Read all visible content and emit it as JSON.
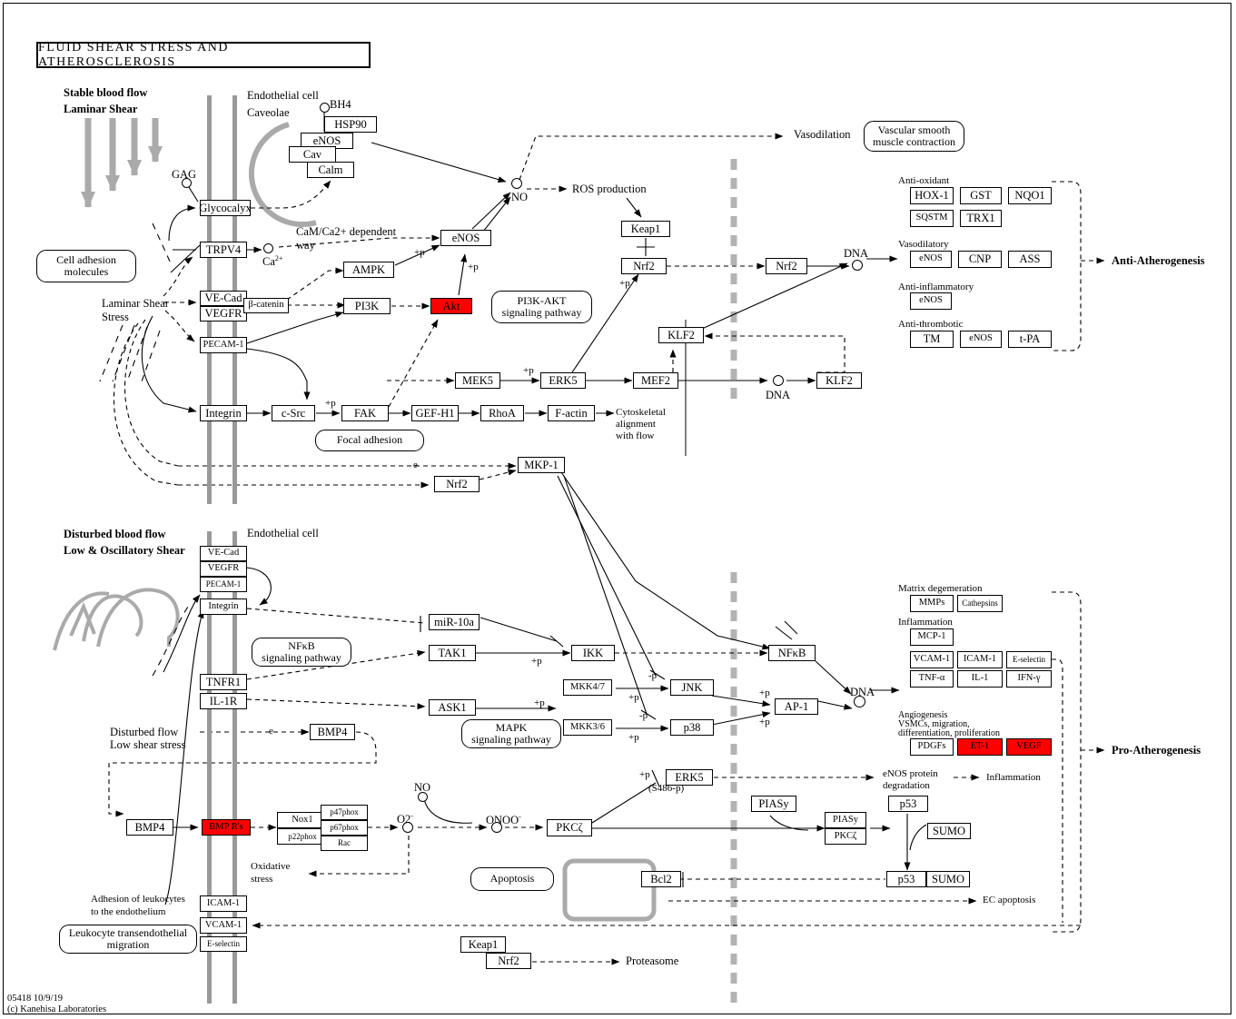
{
  "title": "FLUID  SHEAR  STRESS  AND  ATHEROSCLEROSIS",
  "footer": {
    "line1": "05418 10/9/19",
    "line2": "(c) Kanehisa Laboratories"
  },
  "colors": {
    "highlight": "#FF0000",
    "membrane": "#999999",
    "nucleus_divider": "#B3B3B3",
    "flow_arrow": "#AAAAAA"
  },
  "labels": {
    "stable_flow_1": "Stable blood flow",
    "stable_flow_2": "Laminar Shear",
    "endothelial_cell_top": "Endothelial cell",
    "caveolae": "Caveolae",
    "gag": "GAG",
    "bh4": "BH4",
    "cam_way_1": "CaM/Ca2+ dependent",
    "cam_way_2": "way",
    "calcium": "Ca",
    "calcium_sup": "2+",
    "no": "NO",
    "ros_production": "ROS production",
    "vasodilation": "Vasodilation",
    "dna_1": "DNA",
    "dna_2": "DNA",
    "dna_3": "DNA",
    "laminar_shear_stress_1": "Laminar Shear",
    "laminar_shear_stress_2": "Stress",
    "cytoskeletal_1": "Cytoskeletal",
    "cytoskeletal_2": "alignment",
    "cytoskeletal_3": "with flow",
    "disturbed_flow_1": "Disturbed blood flow",
    "disturbed_flow_2": "Low & Oscillatory Shear",
    "endothelial_cell_bottom": "Endothelial cell",
    "disturbed_flow_low_1": "Disturbed flow",
    "disturbed_flow_low_2": "Low shear stress",
    "no_bottom": "NO",
    "o2_minus": "O2",
    "o2_sup": "-",
    "onoo": "ONOO",
    "onoo_sup": "-",
    "oxidative_1": "Oxidative",
    "oxidative_2": "stress",
    "s486p": "(S486-p)",
    "enos_degradation_1": "eNOS protein",
    "enos_degradation_2": "degradation",
    "inflammation_out": "Inflammation",
    "ec_apoptosis": "EC apoptosis",
    "proteasome": "Proteasome",
    "adhesion_1": "Adhesion of leukocytes",
    "adhesion_2": "to the endothelium",
    "anti_atherogenesis": "Anti-Atherogenesis",
    "pro_atherogenesis": "Pro-Atherogenesis",
    "plus_p": "+p",
    "minus_p": "-p",
    "e_label": "e"
  },
  "rounded_nodes": [
    {
      "id": "cell-adhesion-molecules",
      "text": "Cell adhesion\nmolecules"
    },
    {
      "id": "pi3k-akt-pathway",
      "text": "PI3K-AKT\nsignaling pathway"
    },
    {
      "id": "vascular-smooth-muscle",
      "text": "Vascular smooth\nmuscle contraction"
    },
    {
      "id": "focal-adhesion",
      "text": "Focal adhesion"
    },
    {
      "id": "nfkb-pathway",
      "text": "NFκB\nsignaling pathway"
    },
    {
      "id": "mapk-pathway",
      "text": "MAPK\nsignaling pathway"
    },
    {
      "id": "apoptosis",
      "text": "Apoptosis"
    },
    {
      "id": "leukocyte-migration",
      "text": "Leukocyte transendothelial\nmigration"
    }
  ],
  "genes": {
    "hsp90": "HSP90",
    "enos_cav": "eNOS",
    "cav": "Cav",
    "calm": "Calm",
    "glycocalyx": "Glycocalyx",
    "trpv4": "TRPV4",
    "ve_cad": "VE-Cad",
    "vegfr": "VEGFR",
    "beta_catenin": "β-catenin",
    "pecam1": "PECAM-1",
    "integrin": "Integrin",
    "ampk": "AMPK",
    "pi3k": "PI3K",
    "akt": "Akt",
    "enos2": "eNOS",
    "keap1": "Keap1",
    "nrf2_a": "Nrf2",
    "nrf2_b": "Nrf2",
    "klf2_a": "KLF2",
    "klf2_b": "KLF2",
    "mek5": "MEK5",
    "erk5": "ERK5",
    "mef2": "MEF2",
    "c_src": "c-Src",
    "fak": "FAK",
    "gef_h1": "GEF-H1",
    "rhoa": "RhoA",
    "f_actin": "F-actin",
    "mkp1": "MKP-1",
    "nrf2_c": "Nrf2",
    "ve_cad_2": "VE-Cad",
    "vegfr_2": "VEGFR",
    "pecam1_2": "PECAM-1",
    "integrin_2": "Integrin",
    "mir10a": "miR-10a",
    "tak1": "TAK1",
    "ikk": "IKK",
    "nfkb": "NFκB",
    "tnfr1": "TNFR1",
    "il1r": "IL-1R",
    "ask1": "ASK1",
    "mkk47": "MKK4/7",
    "jnk": "JNK",
    "ap1": "AP-1",
    "mkk346": "MKK3/6",
    "p38": "p38",
    "bmp4_a": "BMP4",
    "bmp4_b": "BMP4",
    "bmprs": "BMP R's",
    "nox1": "Nox1",
    "p22phox": "p22phox",
    "p47phox": "p47phox",
    "p67phox": "p67phox",
    "rac": "Rac",
    "pkcz": "PKCζ",
    "erk5_b": "ERK5",
    "piasy": "PIASy",
    "piasy_c": "PIASy",
    "pkcz_c": "PKCζ",
    "p53": "p53",
    "sumo": "SUMO",
    "p53_b": "p53",
    "sumo_b": "SUMO",
    "bcl2": "Bcl2",
    "icam1": "ICAM-1",
    "vcam1": "VCAM-1",
    "e_selectin": "E-selectin",
    "keap1_b": "Keap1",
    "nrf2_d": "Nrf2"
  },
  "anti_atherogenesis_groups": [
    {
      "group": "Anti-oxidant",
      "rows": [
        [
          "HOX-1",
          "GST",
          "NQO1"
        ],
        [
          "SQSTM",
          "TRX1"
        ]
      ]
    },
    {
      "group": "Vasodilatory",
      "rows": [
        [
          "eNOS",
          "CNP",
          "ASS"
        ]
      ]
    },
    {
      "group": "Anti-inflammatory",
      "rows": [
        [
          "eNOS"
        ]
      ]
    },
    {
      "group": "Anti-thrombotic",
      "rows": [
        [
          "TM",
          "eNOS",
          "t-PA"
        ]
      ]
    }
  ],
  "pro_atherogenesis_groups": [
    {
      "group": "Matrix degemeration",
      "rows": [
        [
          "MMPs",
          "Cathepsins"
        ]
      ]
    },
    {
      "group": "Inflammation",
      "rows": [
        [
          "MCP-1"
        ],
        [
          "VCAM-1",
          "ICAM-1",
          "E-selectin"
        ],
        [
          "TNF-α",
          "IL-1",
          "IFN-γ"
        ]
      ]
    },
    {
      "group": "Angiogenesis\nVSMCs, migration,\ndifferentiation, proliferation",
      "rows": [
        [
          "PDGFs",
          "ET-1",
          "VEGF"
        ]
      ]
    }
  ],
  "highlighted_genes": [
    "Akt",
    "BMP R's",
    "ET-1",
    "VEGF"
  ]
}
